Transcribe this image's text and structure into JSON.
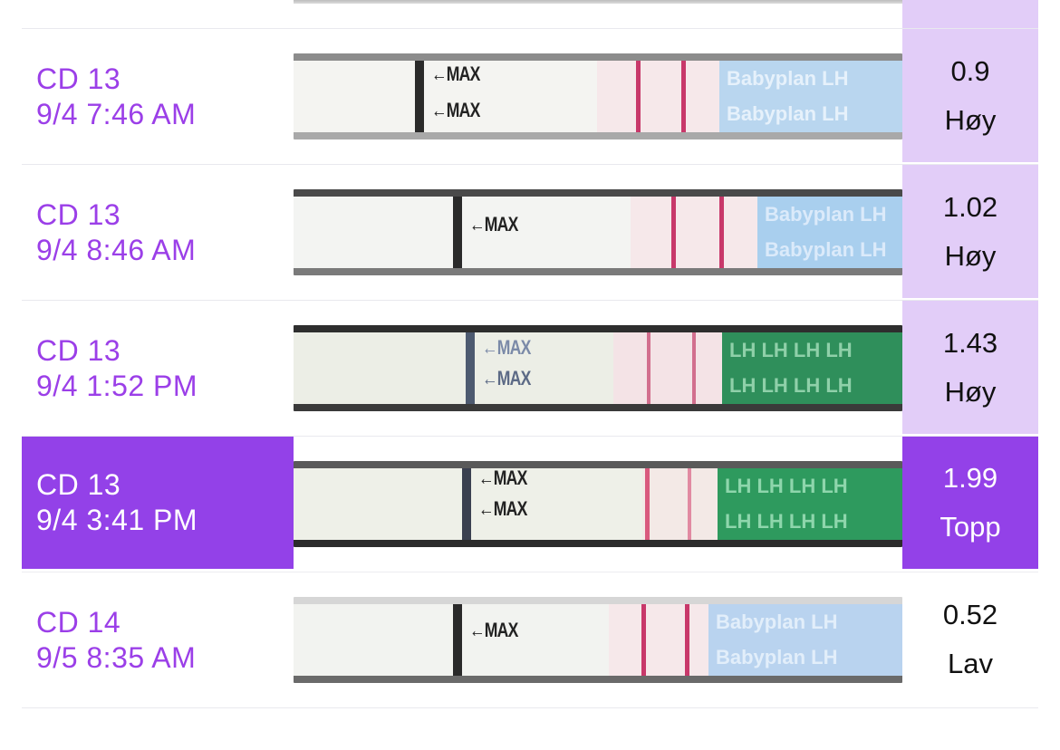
{
  "entries": [
    {
      "cycle_day": "CD 13",
      "datetime": "9/4 7:46 AM",
      "value": "0.9",
      "level": "Høy",
      "strip_text": [
        "MAX",
        "MAX"
      ],
      "brand": "Babyplan LH",
      "brand_color": "#b8d6f0"
    },
    {
      "cycle_day": "CD 13",
      "datetime": "9/4 8:46 AM",
      "value": "1.02",
      "level": "Høy",
      "strip_text": [
        "MAX"
      ],
      "brand": "Babyplan LH",
      "brand_color": "#a9cfee"
    },
    {
      "cycle_day": "CD 13",
      "datetime": "9/4 1:52 PM",
      "value": "1.43",
      "level": "Høy",
      "strip_text": [
        "MAX",
        "MAX"
      ],
      "brand": "LH LH LH LH",
      "brand_color": "#2f8f5b"
    },
    {
      "cycle_day": "CD 13",
      "datetime": "9/4 3:41 PM",
      "value": "1.99",
      "level": "Topp",
      "strip_text": [
        "MAX",
        "MAX"
      ],
      "brand": "LH LH LH LH",
      "brand_color": "#2e9a5e"
    },
    {
      "cycle_day": "CD 14",
      "datetime": "9/5 8:35 AM",
      "value": "0.52",
      "level": "Lav",
      "strip_text": [
        "MAX"
      ],
      "brand": "Babyplan LH",
      "brand_color": "#b9d3ef"
    }
  ],
  "colors": {
    "accent": "#9341e8",
    "highlight": "#e2cdf8",
    "label_text": "#9b3fe8"
  }
}
